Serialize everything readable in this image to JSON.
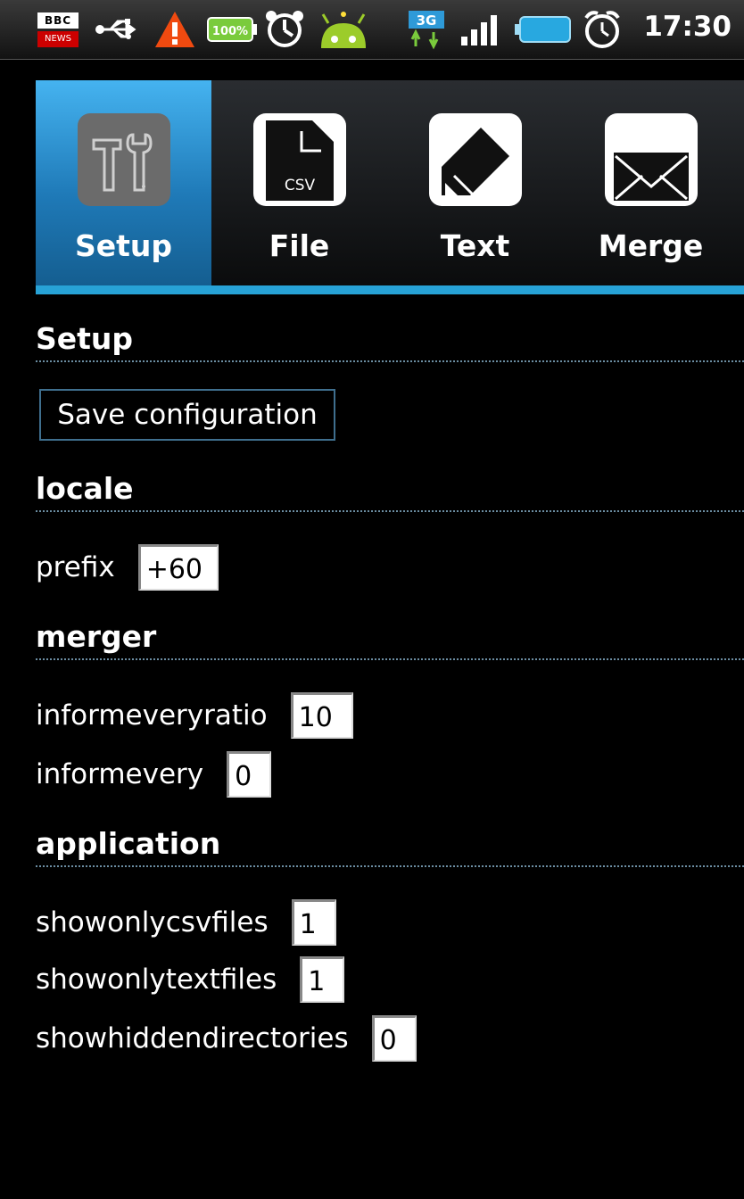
{
  "status_bar": {
    "bbc_text": "BBC",
    "news_text": "NEWS",
    "battery_text": "100%",
    "network_text": "3G",
    "time": "17:30",
    "icons": [
      "bbc-news-icon",
      "usb-icon",
      "warning-icon",
      "battery-indicator-icon",
      "alarm-icon",
      "android-icon",
      "3g-data-icon",
      "signal-icon",
      "battery-icon",
      "alarm-clock-icon"
    ]
  },
  "tabs": [
    {
      "label": "Setup",
      "icon": "tools-icon",
      "active": true
    },
    {
      "label": "File",
      "icon": "csv-file-icon",
      "active": false,
      "icon_text": "CSV"
    },
    {
      "label": "Text",
      "icon": "pencil-icon",
      "active": false
    },
    {
      "label": "Merge",
      "icon": "envelope-icon",
      "active": false
    }
  ],
  "setup": {
    "heading": "Setup",
    "save_button": "Save configuration"
  },
  "locale": {
    "heading": "locale",
    "prefix_label": "prefix",
    "prefix_value": "+60"
  },
  "merger": {
    "heading": "merger",
    "informeveryratio_label": "informeveryratio",
    "informeveryratio_value": "10",
    "informevery_label": "informevery",
    "informevery_value": "0"
  },
  "application": {
    "heading": "application",
    "showonlycsvfiles_label": "showonlycsvfiles",
    "showonlycsvfiles_value": "1",
    "showonlytextfiles_label": "showonlytextfiles",
    "showonlytextfiles_value": "1",
    "showhiddendirectories_label": "showhiddendirectories",
    "showhiddendirectories_value": "0"
  },
  "colors": {
    "accent": "#27a2d6",
    "active_tab": "#1f7ab8",
    "background": "#000000",
    "divider": "#6c8ea3"
  }
}
